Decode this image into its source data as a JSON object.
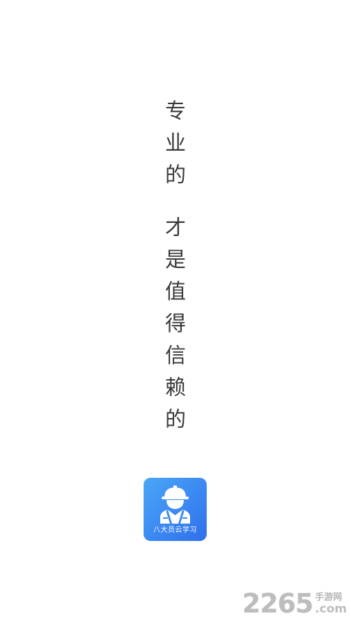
{
  "slogan": {
    "line1": [
      "专",
      "业",
      "的"
    ],
    "line2": [
      "才",
      "是",
      "值",
      "得",
      "信",
      "赖",
      "的"
    ]
  },
  "app_icon": {
    "label": "八大员云学习",
    "icon_name": "construction-worker-icon",
    "gradient_colors": [
      "#4aa6f5",
      "#2f6fe9"
    ]
  },
  "watermark": {
    "number": "2265",
    "site_cn": "手游网",
    "domain": ".com"
  }
}
